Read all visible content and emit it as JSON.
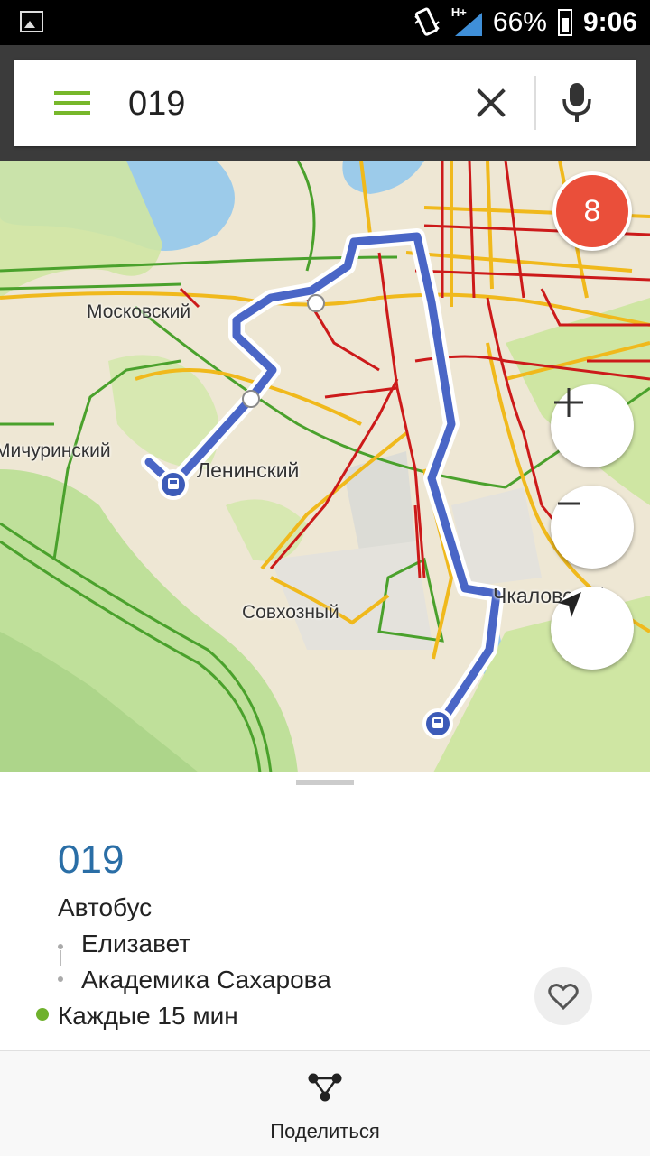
{
  "status_bar": {
    "network": "H+",
    "battery": "66%",
    "time": "9:06"
  },
  "search": {
    "value": "019",
    "icons": [
      "menu-icon",
      "close-icon",
      "microphone-icon"
    ]
  },
  "map": {
    "traffic_level": "8",
    "labels": {
      "moskovsky": "Московский",
      "michurinsky": "Мичуринский",
      "leninsky": "Ленинский",
      "sovkhozny": "Совхозный",
      "chkalovsky": "Чкаловский"
    },
    "controls": [
      "zoom-in-icon",
      "zoom-out-icon",
      "my-location-icon"
    ],
    "colors": {
      "route": "#4a66c6",
      "traffic_red": "#cc1a1a",
      "traffic_yellow": "#f0b91c",
      "traffic_green": "#4aa12c"
    }
  },
  "route_card": {
    "number": "019",
    "type": "Автобус",
    "stops": [
      "Елизавет",
      "Академика Сахарова"
    ],
    "frequency": "Каждые 15 мин"
  },
  "bottom_bar": {
    "share_label": "Поделиться"
  }
}
